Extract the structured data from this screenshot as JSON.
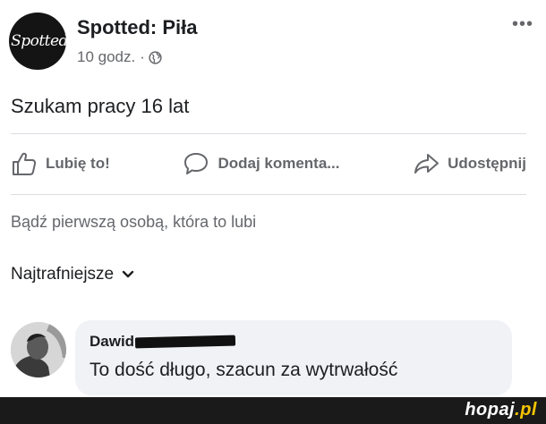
{
  "post": {
    "page_avatar_text": "Spotted",
    "page_name": "Spotted: Piła",
    "time": "10 godz.",
    "separator": "·",
    "more_label": "•••",
    "text": "Szukam pracy 16 lat"
  },
  "actions": {
    "like": "Lubię to!",
    "comment": "Dodaj komenta...",
    "share": "Udostępnij"
  },
  "likes_text": "Bądź pierwszą osobą, która to lubi",
  "sort_label": "Najtrafniejsze",
  "comment": {
    "author": "Dawid",
    "text": "To dość długo, szacun za wytrwałość"
  },
  "watermark": {
    "main": "hopaj",
    "suffix": ".pl"
  },
  "icons": {
    "globe": "globe-icon",
    "like": "thumbs-up-icon",
    "comment": "speech-bubble-icon",
    "share": "share-arrow-icon",
    "chevron": "chevron-down-icon"
  },
  "colors": {
    "text": "#1c1e21",
    "secondary": "#65676b",
    "bubble": "#f0f2f5",
    "divider": "#dadde1",
    "watermark_accent": "#f5c400"
  }
}
